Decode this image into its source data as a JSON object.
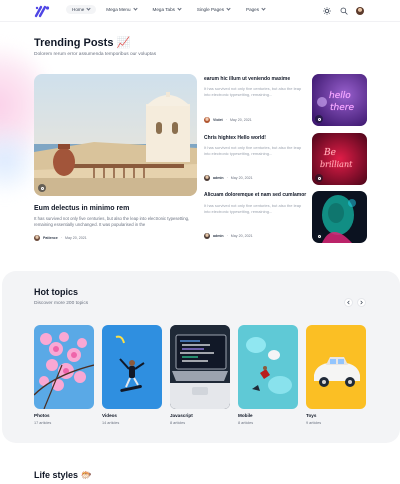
{
  "header": {
    "nav": [
      {
        "label": "Home"
      },
      {
        "label": "Mega Menu"
      },
      {
        "label": "Mega Tabs"
      },
      {
        "label": "Single Pages"
      },
      {
        "label": "Pages"
      }
    ],
    "icons": [
      "sun-icon",
      "search-icon",
      "avatar"
    ]
  },
  "trending": {
    "title": "Trending Posts 📈",
    "subtitle": "Dolorem rerum error assumenda temporibus our voluptas",
    "main_post": {
      "title": "Eum delectus in minimo rem",
      "excerpt": "It has survived not only five centuries, but also the leap into electronic typesetting, remaining essentially unchanged. It was popularised in the",
      "author": "Patience",
      "date": "May 20, 2021"
    },
    "side_posts": [
      {
        "title": "earum hic illum ut veniendo maxime",
        "excerpt": "It has survived not only five centuries, but also the leap into electronic typesetting, remaining...",
        "author": "Violet",
        "date": "May 20, 2021"
      },
      {
        "title": "Chris hightex Hello world!",
        "excerpt": "It has survived not only five centuries, but also the leap into electronic typesetting, remaining...",
        "author": "admin",
        "date": "May 20, 2021"
      },
      {
        "title": "Alicuam doloremque et nam sed cumlamor",
        "excerpt": "It has survived not only five centuries, but also the leap into electronic typesetting, remaining...",
        "author": "admin",
        "date": "May 20, 2021"
      }
    ]
  },
  "hot_topics": {
    "title": "Hot topics",
    "subtitle": "Discover more 200 topics",
    "items": [
      {
        "name": "Photos",
        "count": "17 articles"
      },
      {
        "name": "Videos",
        "count": "14 articles"
      },
      {
        "name": "Javascript",
        "count": "8 articles"
      },
      {
        "name": "Mobile",
        "count": "8 articles"
      },
      {
        "name": "Toys",
        "count": "9 articles"
      }
    ]
  },
  "life_styles": {
    "title": "Life styles 🐡"
  },
  "colors": {
    "brand": "#4f46e5",
    "section_bg": "#f3f4f6",
    "text": "#111827",
    "muted": "#6b7280"
  }
}
